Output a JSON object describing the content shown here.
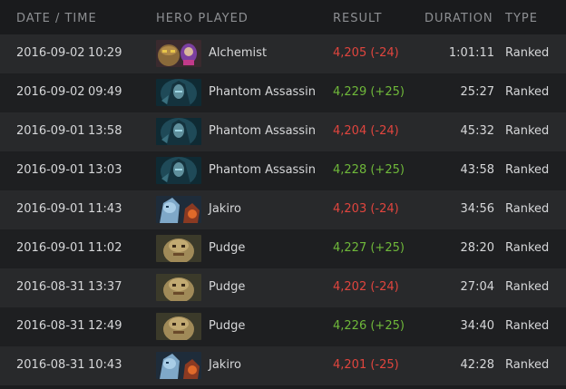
{
  "columns": {
    "date_time": "DATE / TIME",
    "hero": "HERO PLAYED",
    "result": "RESULT",
    "duration": "DURATION",
    "type": "TYPE"
  },
  "colors": {
    "win": "#6fb83a",
    "loss": "#e0453e"
  },
  "matches": [
    {
      "date": "2016-09-02",
      "time": "10:29",
      "hero": "Alchemist",
      "hero_icon": "alchemist-portrait-icon",
      "result": "4,205 (-24)",
      "outcome": "loss",
      "duration": "1:01:11",
      "type": "Ranked"
    },
    {
      "date": "2016-09-02",
      "time": "09:49",
      "hero": "Phantom Assassin",
      "hero_icon": "phantom-assassin-portrait-icon",
      "result": "4,229 (+25)",
      "outcome": "win",
      "duration": "25:27",
      "type": "Ranked"
    },
    {
      "date": "2016-09-01",
      "time": "13:58",
      "hero": "Phantom Assassin",
      "hero_icon": "phantom-assassin-portrait-icon",
      "result": "4,204 (-24)",
      "outcome": "loss",
      "duration": "45:32",
      "type": "Ranked"
    },
    {
      "date": "2016-09-01",
      "time": "13:03",
      "hero": "Phantom Assassin",
      "hero_icon": "phantom-assassin-portrait-icon",
      "result": "4,228 (+25)",
      "outcome": "win",
      "duration": "43:58",
      "type": "Ranked"
    },
    {
      "date": "2016-09-01",
      "time": "11:43",
      "hero": "Jakiro",
      "hero_icon": "jakiro-portrait-icon",
      "result": "4,203 (-24)",
      "outcome": "loss",
      "duration": "34:56",
      "type": "Ranked"
    },
    {
      "date": "2016-09-01",
      "time": "11:02",
      "hero": "Pudge",
      "hero_icon": "pudge-portrait-icon",
      "result": "4,227 (+25)",
      "outcome": "win",
      "duration": "28:20",
      "type": "Ranked"
    },
    {
      "date": "2016-08-31",
      "time": "13:37",
      "hero": "Pudge",
      "hero_icon": "pudge-portrait-icon",
      "result": "4,202 (-24)",
      "outcome": "loss",
      "duration": "27:04",
      "type": "Ranked"
    },
    {
      "date": "2016-08-31",
      "time": "12:49",
      "hero": "Pudge",
      "hero_icon": "pudge-portrait-icon",
      "result": "4,226 (+25)",
      "outcome": "win",
      "duration": "34:40",
      "type": "Ranked"
    },
    {
      "date": "2016-08-31",
      "time": "10:43",
      "hero": "Jakiro",
      "hero_icon": "jakiro-portrait-icon",
      "result": "4,201 (-25)",
      "outcome": "loss",
      "duration": "42:28",
      "type": "Ranked"
    }
  ]
}
